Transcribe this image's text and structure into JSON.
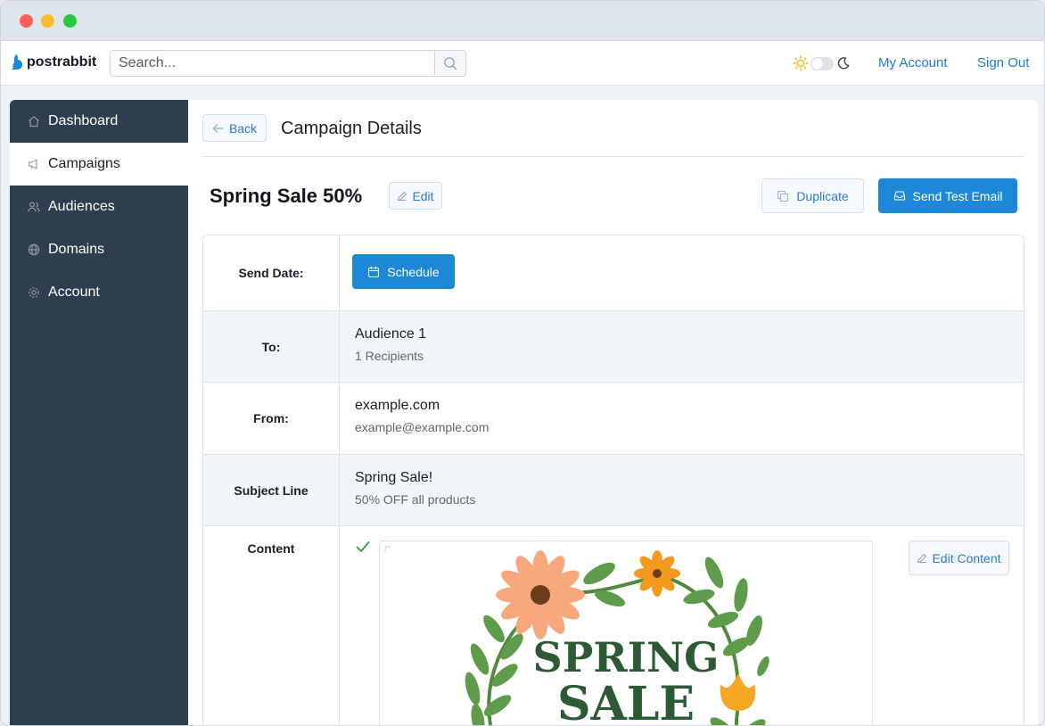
{
  "brand": {
    "name": "postrabbit"
  },
  "search": {
    "placeholder": "Search..."
  },
  "nav": {
    "my_account": "My Account",
    "sign_out": "Sign Out"
  },
  "sidebar": {
    "items": [
      {
        "label": "Dashboard",
        "icon": "home-icon"
      },
      {
        "label": "Campaigns",
        "icon": "megaphone-icon"
      },
      {
        "label": "Audiences",
        "icon": "users-icon"
      },
      {
        "label": "Domains",
        "icon": "globe-icon"
      },
      {
        "label": "Account",
        "icon": "gear-icon"
      }
    ],
    "active": "Campaigns"
  },
  "header": {
    "back_label": "Back",
    "title": "Campaign Details"
  },
  "campaign": {
    "name": "Spring Sale 50%",
    "edit_label": "Edit",
    "duplicate_label": "Duplicate",
    "send_test_label": "Send Test Email"
  },
  "details": {
    "send_date": {
      "label": "Send Date:",
      "button": "Schedule"
    },
    "to": {
      "label": "To:",
      "audience": "Audience 1",
      "recipients": "1 Recipients"
    },
    "from": {
      "label": "From:",
      "domain": "example.com",
      "email": "example@example.com"
    },
    "subject": {
      "label": "Subject Line",
      "subject": "Spring Sale!",
      "preview": "50% OFF all products"
    },
    "content": {
      "label": "Content",
      "edit_button": "Edit Content",
      "image_text_line1": "SPRING",
      "image_text_line2": "SALE"
    }
  },
  "colors": {
    "accent": "#1e88d8",
    "sidebar_bg": "#2f3e4e",
    "link": "#1f7ad1",
    "success": "#2e9e4a"
  }
}
